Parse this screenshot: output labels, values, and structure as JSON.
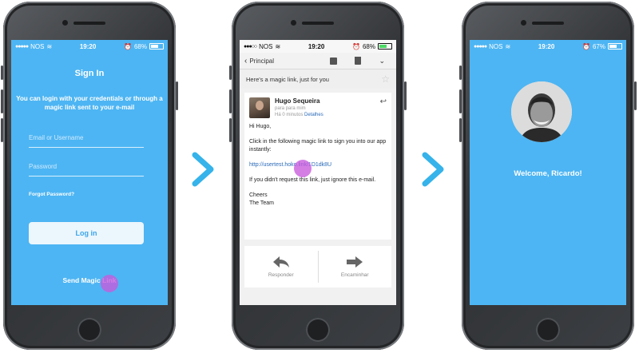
{
  "status_left": "NOS",
  "screen1": {
    "time": "19:20",
    "battery": "68%",
    "title": "Sign In",
    "description": "You can login with your credentials or through a magic link sent to your e-mail",
    "username_placeholder": "Email or Username",
    "password_placeholder": "Password",
    "forgot": "Forgot Password?",
    "login": "Log in",
    "send_magic_link": "Send Magic Link",
    "bg_color": "#4db5f3"
  },
  "screen2": {
    "time": "19:20",
    "battery": "68%",
    "back_label": "Principal",
    "subject": "Here's a magic link, just for you",
    "sender_name": "Hugo Sequeira",
    "sender_to": "para para mim",
    "sender_time": "Há 0 minutos",
    "details": "Detalhes",
    "greeting": "Hi Hugo,",
    "instruction": "Click in the following magic link to sign you into our app instantly:",
    "magic_link": "http://usertest.hoko.link/1D1dk8U",
    "ignore": "If you didn't request this link, just ignore this e-mail.",
    "sign_off_1": "Cheers",
    "sign_off_2": "The Team",
    "reply_action": "Responder",
    "forward_action": "Encaminhar"
  },
  "screen3": {
    "time": "19:20",
    "battery": "67%",
    "welcome": "Welcome, Ricardo!"
  },
  "arrow_color": "#35b3ea"
}
